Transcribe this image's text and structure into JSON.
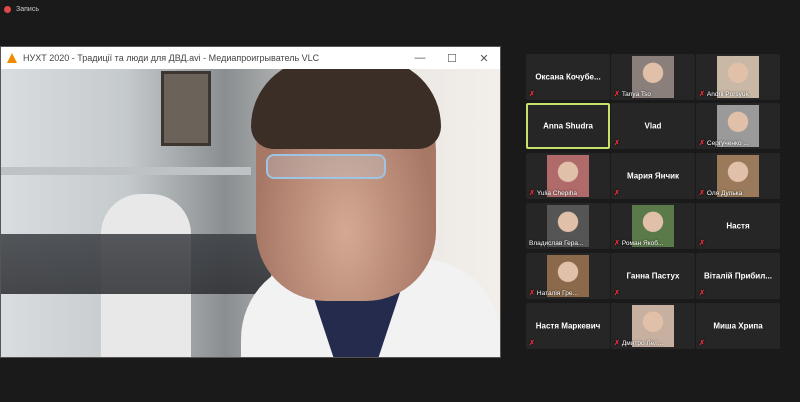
{
  "recording": {
    "label": "Запись",
    "color": "#e04848"
  },
  "vlc": {
    "title": "НУХТ 2020 - Традиції та люди для ДВД.avi - Медиапроигрыватель VLC",
    "minimize": "—",
    "maximize": "☐",
    "close": "✕"
  },
  "participants": [
    {
      "name": "Оксана  Кочубе...",
      "photo": false,
      "muted": true
    },
    {
      "name": "Tanya Tso",
      "photo": true,
      "muted": true,
      "color": "#8a7f7a"
    },
    {
      "name": "Andrii Porsyuk",
      "photo": true,
      "muted": true,
      "color": "#c9b8a5"
    },
    {
      "name": "Anna Shudra",
      "photo": false,
      "muted": false,
      "active": true
    },
    {
      "name": "Vlad",
      "photo": false,
      "muted": true
    },
    {
      "name": "Сергученко ...",
      "photo": true,
      "muted": true,
      "color": "#9a9a9a"
    },
    {
      "name": "Yulia Chepiha",
      "photo": true,
      "muted": true,
      "color": "#b06a6a"
    },
    {
      "name": "Мария Янчик",
      "photo": false,
      "muted": true
    },
    {
      "name": "Оля Дулька",
      "photo": true,
      "muted": true,
      "color": "#9a7a5a"
    },
    {
      "name": "Владислав Гера...",
      "photo": true,
      "muted": false,
      "color": "#555555"
    },
    {
      "name": "Роман Якоб...",
      "photo": true,
      "muted": true,
      "color": "#5a7a4a"
    },
    {
      "name": "Настя",
      "photo": false,
      "muted": true
    },
    {
      "name": "Наталія Гре...",
      "photo": true,
      "muted": true,
      "color": "#8a6a4a"
    },
    {
      "name": "Ганна Пастух",
      "photo": false,
      "muted": true
    },
    {
      "name": "Віталій  Прибил...",
      "photo": false,
      "muted": true
    },
    {
      "name": "Настя Маркевич",
      "photo": false,
      "muted": true
    },
    {
      "name": "Дмитро Лел...",
      "photo": true,
      "muted": true,
      "color": "#c8b0a0"
    },
    {
      "name": "Миша Хрипа",
      "photo": false,
      "muted": true
    }
  ]
}
